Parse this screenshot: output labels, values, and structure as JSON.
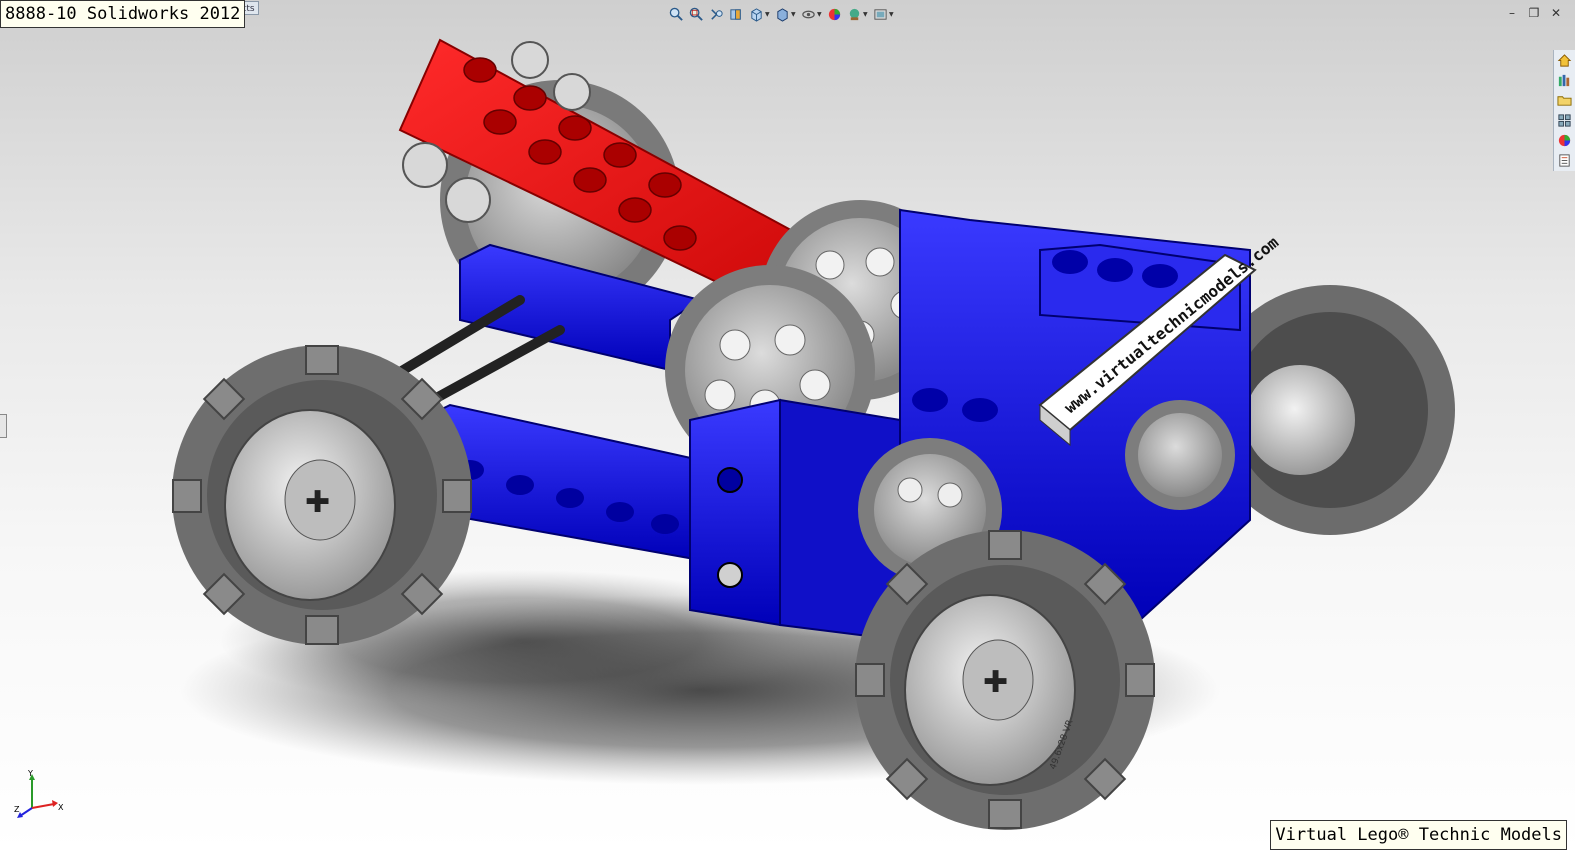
{
  "window": {
    "title_label": "8888-10 Solidworks 2012",
    "products_tab": "ducts"
  },
  "view_toolbar": {
    "buttons": [
      {
        "icon": "zoom-to-fit-icon"
      },
      {
        "icon": "zoom-to-area-icon"
      },
      {
        "icon": "previous-view-icon"
      },
      {
        "icon": "section-view-icon"
      },
      {
        "icon": "view-orientation-icon"
      },
      {
        "icon": "display-style-icon"
      },
      {
        "icon": "hide-show-items-icon"
      },
      {
        "icon": "edit-appearance-icon"
      },
      {
        "icon": "apply-scene-icon"
      },
      {
        "icon": "view-settings-icon"
      }
    ]
  },
  "window_controls": {
    "minimize": "–",
    "restore": "❐",
    "close": "✕"
  },
  "task_pane": {
    "tabs": [
      {
        "icon": "solidworks-resources-icon"
      },
      {
        "icon": "design-library-icon"
      },
      {
        "icon": "file-explorer-icon"
      },
      {
        "icon": "view-palette-icon"
      },
      {
        "icon": "appearances-scenes-icon"
      },
      {
        "icon": "custom-properties-icon"
      }
    ]
  },
  "model": {
    "plate_text": "www.virtualtechnicmodels.com",
    "tire_text": "49.6x28 VR",
    "colors": {
      "blue": "#1a1adf",
      "red": "#ee1010",
      "gray": "#8a8a8a",
      "white": "#f4f4f4"
    }
  },
  "triad": {
    "x": "X",
    "y": "Y",
    "z": "Z"
  },
  "footer": {
    "label": "Virtual Lego® Technic Models"
  }
}
